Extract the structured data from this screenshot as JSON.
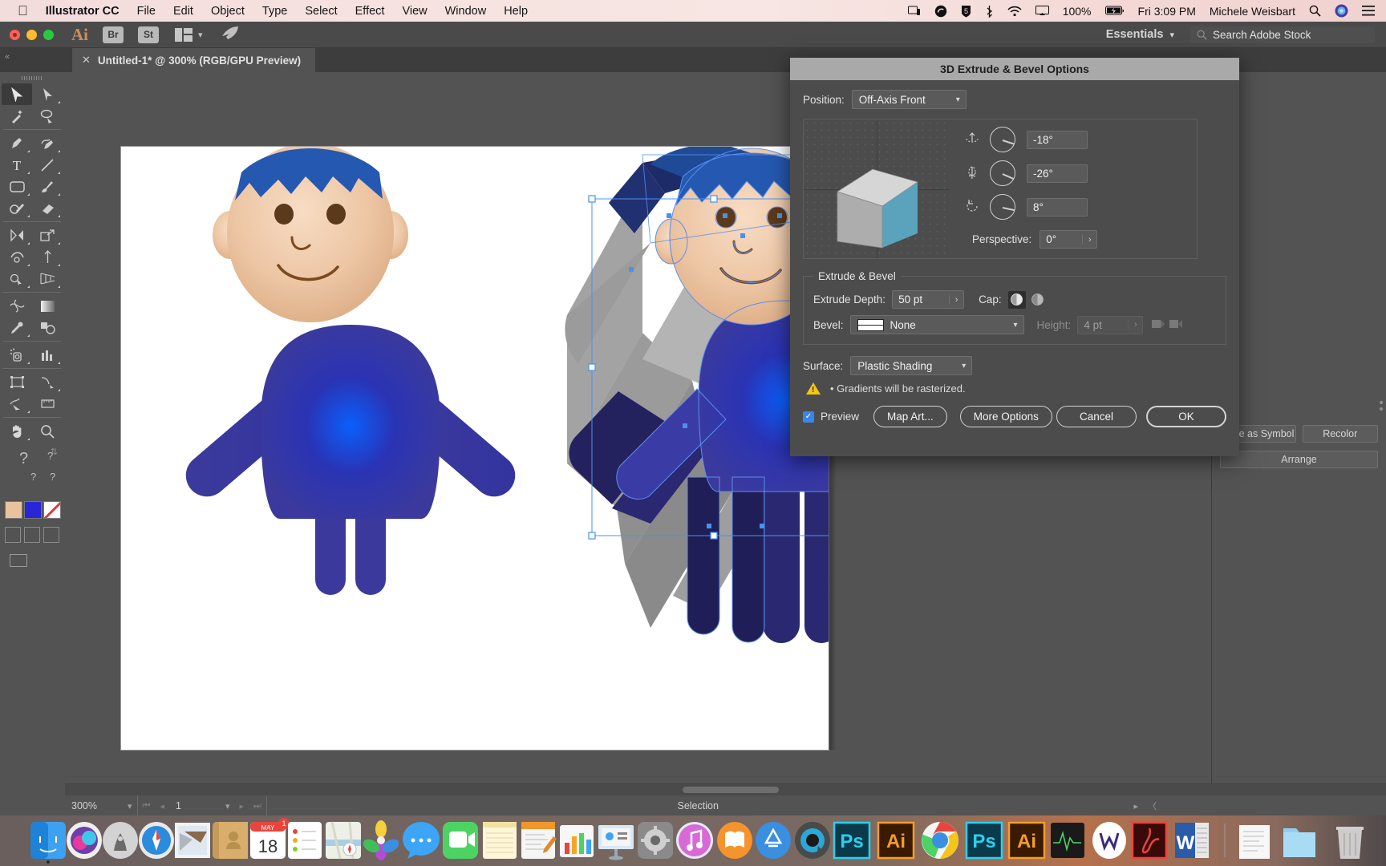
{
  "macos_menubar": {
    "apple_icon": "apple-icon",
    "app_name": "Illustrator CC",
    "menus": [
      "File",
      "Edit",
      "Object",
      "Type",
      "Select",
      "Effect",
      "View",
      "Window",
      "Help"
    ],
    "status_icons": [
      "airplay-display-icon",
      "creative-cloud-icon",
      "shield5-icon",
      "bluetooth-icon",
      "wifi-icon",
      "screen-mirror-icon"
    ],
    "battery_percent": "100%",
    "battery_icon": "battery-charging-icon",
    "clock": "Fri 3:09 PM",
    "user_name": "Michele Weisbart",
    "spotlight_icon": "search-icon",
    "siri_icon": "siri-icon",
    "notification_icon": "notification-center-icon"
  },
  "app_topbar": {
    "app_mark": "Ai",
    "bridge_button": "Br",
    "stock_button": "St",
    "arrange_icon": "arrange-documents-icon",
    "chevron_icon": "chevron-down-icon",
    "rocket_icon": "rocket-icon",
    "workspace": "Essentials",
    "workspace_chevron": "chevron-down-icon",
    "stock_search_placeholder": "Search Adobe Stock",
    "stock_search_value": "",
    "stock_search_icon": "search-icon"
  },
  "document_tab": {
    "close_icon": "close-icon",
    "title": "Untitled-1* @ 300% (RGB/GPU Preview)",
    "collapse_icon": "collapse-panel-icon"
  },
  "tools_panel": {
    "tools": [
      {
        "name": "selection-tool",
        "selected": true
      },
      {
        "name": "direct-selection-tool",
        "selected": false
      },
      {
        "name": "magic-wand-tool",
        "selected": false
      },
      {
        "name": "lasso-tool",
        "selected": false
      },
      {
        "name": "pen-tool",
        "selected": false
      },
      {
        "name": "curvature-tool",
        "selected": false
      },
      {
        "name": "type-tool",
        "selected": false
      },
      {
        "name": "line-segment-tool",
        "selected": false
      },
      {
        "name": "rectangle-tool",
        "selected": false
      },
      {
        "name": "paintbrush-tool",
        "selected": false
      },
      {
        "name": "shaper-tool",
        "selected": false
      },
      {
        "name": "eraser-tool",
        "selected": false
      },
      {
        "name": "rotate-tool",
        "selected": false
      },
      {
        "name": "scale-tool",
        "selected": false
      },
      {
        "name": "width-tool",
        "selected": false
      },
      {
        "name": "free-transform-tool",
        "selected": false
      },
      {
        "name": "shape-builder-tool",
        "selected": false
      },
      {
        "name": "perspective-grid-tool",
        "selected": false
      },
      {
        "name": "mesh-tool",
        "selected": false
      },
      {
        "name": "gradient-tool",
        "selected": false
      },
      {
        "name": "eyedropper-tool",
        "selected": false
      },
      {
        "name": "blend-tool",
        "selected": false
      },
      {
        "name": "symbol-sprayer-tool",
        "selected": false
      },
      {
        "name": "column-graph-tool",
        "selected": false
      },
      {
        "name": "artboard-tool",
        "selected": false
      },
      {
        "name": "slice-tool",
        "selected": false
      },
      {
        "name": "hand-tool",
        "selected": false
      },
      {
        "name": "zoom-tool",
        "selected": false
      }
    ],
    "fill_color": "#e8c39e",
    "stroke_color": "#ffffff",
    "swatches": [
      "#e8c39e",
      "#2727d8",
      "none"
    ]
  },
  "right_panel": {
    "save_as_symbol": "Save as Symbol",
    "recolor": "Recolor",
    "arrange": "Arrange"
  },
  "status_bar": {
    "zoom": "300%",
    "zoom_chevron": "chevron-down-icon",
    "first_page_icon": "first-page-icon",
    "prev_page_icon": "previous-page-icon",
    "page_number": "1",
    "page_chevron": "chevron-down-icon",
    "next_page_icon": "next-page-icon",
    "last_page_icon": "last-page-icon",
    "tool_status": "Selection",
    "status_caret": "play-caret-icon",
    "back_caret": "left-caret-icon"
  },
  "dialog": {
    "title": "3D Extrude & Bevel Options",
    "position_label": "Position:",
    "position_value": "Off-Axis Front",
    "position_chevron": "chevron-down-icon",
    "rotate_x_icon": "rotate-x-axis-icon",
    "rotate_x_value": "-18°",
    "rotate_x_angle": -18,
    "rotate_y_icon": "rotate-y-axis-icon",
    "rotate_y_value": "-26°",
    "rotate_y_angle": -26,
    "rotate_z_icon": "rotate-z-axis-icon",
    "rotate_z_value": "8°",
    "rotate_z_angle": 8,
    "perspective_label": "Perspective:",
    "perspective_value": "0°",
    "perspective_stepper_icon": "stepper-arrow-icon",
    "cube_front_color": "#5ba3bd",
    "cube_top_color": "#d6d6d6",
    "cube_side_color": "#adadad",
    "group_legend": "Extrude & Bevel",
    "extrude_depth_label": "Extrude Depth:",
    "extrude_depth_value": "50 pt",
    "extrude_depth_stepper_icon": "stepper-arrow-icon",
    "cap_label": "Cap:",
    "cap_on_icon": "cap-solid-icon",
    "cap_off_icon": "cap-hollow-icon",
    "bevel_label": "Bevel:",
    "bevel_value": "None",
    "bevel_swatch_icon": "bevel-none-swatch-icon",
    "bevel_chevron": "chevron-down-icon",
    "height_label": "Height:",
    "height_value": "4 pt",
    "height_stepper_icon": "stepper-arrow-icon",
    "bevel_extent_out_icon": "bevel-extent-out-icon",
    "bevel_extent_in_icon": "bevel-extent-in-icon",
    "surface_label": "Surface:",
    "surface_value": "Plastic Shading",
    "surface_chevron": "chevron-down-icon",
    "warning_icon": "warning-triangle-icon",
    "warning_text": "• Gradients will be rasterized.",
    "preview_label": "Preview",
    "preview_checked": true,
    "map_art_button": "Map Art...",
    "more_options_button": "More Options",
    "cancel_button": "Cancel",
    "ok_button": "OK"
  },
  "artwork": {
    "figure_flat_name": "flat-character-artwork",
    "figure_3d_name": "extruded-character-artwork",
    "skin_color": "#e9bd99",
    "hair_color": "#2558b0",
    "shirt_color": "#3a3aa8",
    "shirt_glow_color": "#1a5cf0",
    "extrude_gray": "#9a9a9a",
    "selection_color": "#4a90f0"
  },
  "dock": {
    "apps": [
      "Finder",
      "Siri",
      "Launchpad",
      "Safari",
      "Mail",
      "Contacts",
      "Calendar",
      "Reminders",
      "Maps",
      "Photos",
      "Messages",
      "FaceTime",
      "Notes",
      "Pages",
      "Numbers",
      "Keynote",
      "System Preferences",
      "iTunes",
      "iBooks",
      "App Store",
      "QuickTime Player",
      "Photoshop",
      "Illustrator",
      "Chrome",
      "Photoshop CC",
      "Illustrator CC",
      "Activity Monitor",
      "Wacom",
      "Acrobat",
      "Word",
      "Documents",
      "Downloads",
      "Trash"
    ]
  }
}
